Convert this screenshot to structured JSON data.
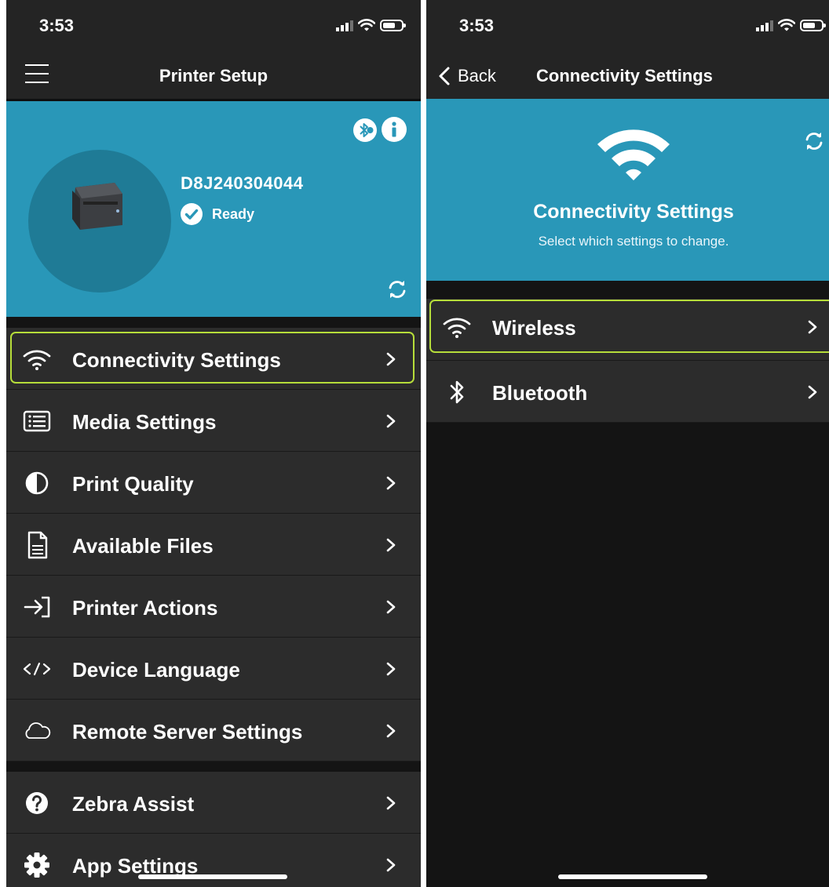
{
  "left": {
    "status": {
      "time": "3:53"
    },
    "nav": {
      "title": "Printer Setup"
    },
    "printer": {
      "serial": "D8J240304044",
      "status": "Ready"
    },
    "menu": [
      {
        "label": "Connectivity Settings",
        "icon": "wifi-icon",
        "selected": true
      },
      {
        "label": "Media Settings",
        "icon": "list-icon"
      },
      {
        "label": "Print Quality",
        "icon": "contrast-icon"
      },
      {
        "label": "Available Files",
        "icon": "file-icon"
      },
      {
        "label": "Printer Actions",
        "icon": "login-arrow-icon"
      },
      {
        "label": "Device Language",
        "icon": "code-icon"
      },
      {
        "label": "Remote Server Settings",
        "icon": "cloud-icon"
      }
    ],
    "menu2": [
      {
        "label": "Zebra Assist",
        "icon": "question-icon"
      },
      {
        "label": "App Settings",
        "icon": "gear-icon"
      }
    ]
  },
  "right": {
    "status": {
      "time": "3:53"
    },
    "nav": {
      "back": "Back",
      "title": "Connectivity Settings"
    },
    "hero": {
      "title": "Connectivity Settings",
      "subtitle": "Select which settings to change."
    },
    "menu": [
      {
        "label": "Wireless",
        "icon": "wifi-icon",
        "selected": true
      },
      {
        "label": "Bluetooth",
        "icon": "bluetooth-icon"
      }
    ]
  },
  "colors": {
    "hero": "#2997b8",
    "hero_circle": "#1f7b96",
    "selection": "#b6dd3a",
    "row": "#2c2c2c",
    "bar": "#242424"
  }
}
